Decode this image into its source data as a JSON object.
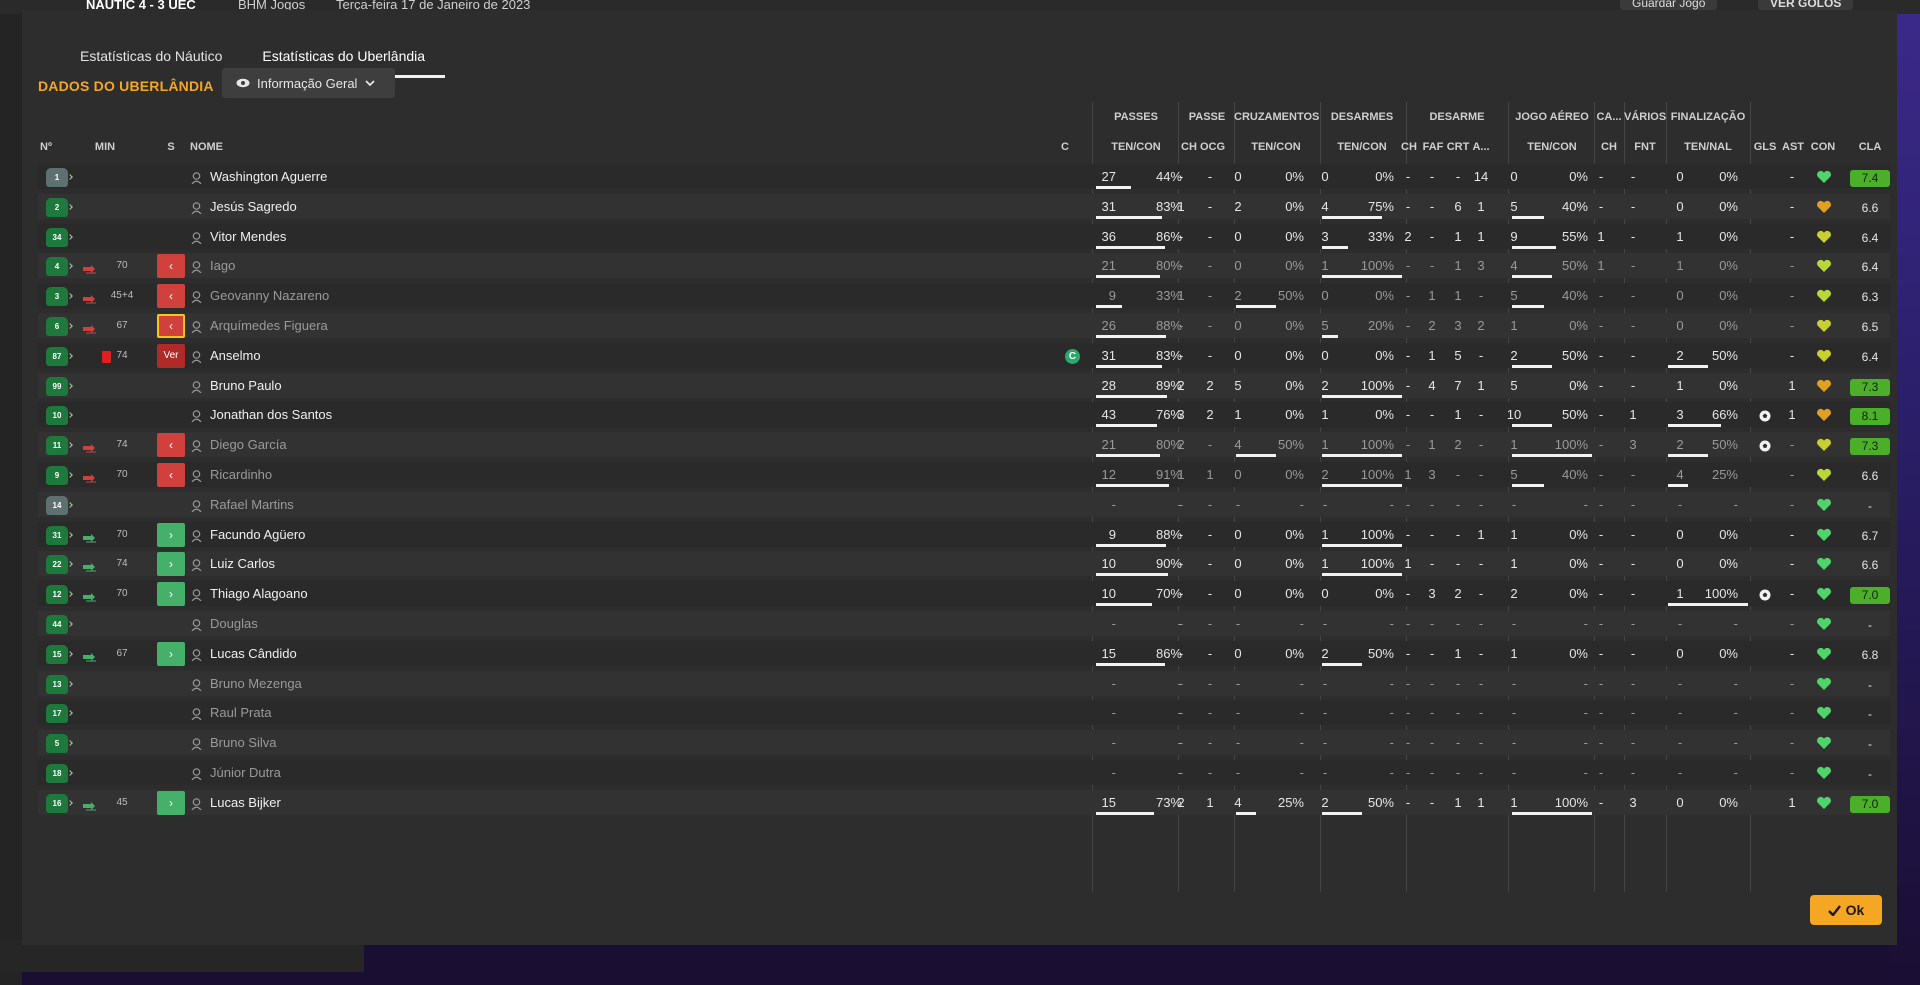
{
  "topbar": {
    "match": "NÁUTIC  4 - 3  UEC",
    "channel": "BHM Jogos",
    "date": "Terça-feira 17 de Janeiro de 2023",
    "save_button": "Guardar Jogo",
    "goals_button": "VER GOLOS"
  },
  "tabs": [
    "Estatísticas do Náutico",
    "Estatísticas do Uberlândia"
  ],
  "active_tab": 1,
  "section_title": "DADOS DO UBERLÂNDIA",
  "view_select": {
    "label": "Informação Geral"
  },
  "groups": [
    "PASSES",
    "PASSE",
    "CRUZAMENTOS",
    "DESARMES",
    "DESARME",
    "JOGO AÉREO",
    "CA...",
    "VÁRIOS",
    "FINALIZAÇÃO"
  ],
  "headers": {
    "num": "Nº",
    "min": "MIN",
    "s": "S",
    "name": "NOME",
    "c": "C",
    "passes": "TEN/CON",
    "passe_ch": "CH",
    "passe_ocg": "OCG",
    "cruz": "TEN/CON",
    "desarmes": "TEN/CON",
    "des_ch": "CH",
    "des_faf": "FAF",
    "des_crt": "CRT",
    "des_a": "A...",
    "aereo": "TEN/CON",
    "ca_ch": "CH",
    "varios_fnt": "FNT",
    "final": "TEN/NAL",
    "gls": "GLS",
    "ast": "AST",
    "con": "CON",
    "cla": "CLA"
  },
  "players": [
    {
      "num": "1",
      "gk": true,
      "min": "",
      "sub": "",
      "s": "",
      "name": "Washington Aguerre",
      "cap": false,
      "dim": false,
      "pt": "27",
      "pp": "44%",
      "ch": "-",
      "ocg": "-",
      "ct": "0",
      "cp": "0%",
      "dt": "0",
      "dp": "0%",
      "dch": "-",
      "faf": "-",
      "crt": "-",
      "da": "14",
      "at": "0",
      "ap": "0%",
      "cach": "-",
      "fnt": "-",
      "ft": "0",
      "fp": "0%",
      "gls": "",
      "ast": "-",
      "cla": "7.4",
      "good": true,
      "heart": "#4fd46a"
    },
    {
      "num": "2",
      "gk": false,
      "min": "",
      "sub": "",
      "s": "",
      "name": "Jesús Sagredo",
      "cap": false,
      "dim": false,
      "pt": "31",
      "pp": "83%",
      "ch": "1",
      "ocg": "-",
      "ct": "2",
      "cp": "0%",
      "dt": "4",
      "dp": "75%",
      "dch": "-",
      "faf": "-",
      "crt": "6",
      "da": "1",
      "at": "5",
      "ap": "40%",
      "cach": "-",
      "fnt": "-",
      "ft": "0",
      "fp": "0%",
      "gls": "",
      "ast": "-",
      "cla": "6.6",
      "good": false,
      "heart": "#e0a020"
    },
    {
      "num": "34",
      "gk": false,
      "min": "",
      "sub": "",
      "s": "",
      "name": "Vitor Mendes",
      "cap": false,
      "dim": false,
      "pt": "36",
      "pp": "86%",
      "ch": "-",
      "ocg": "-",
      "ct": "0",
      "cp": "0%",
      "dt": "3",
      "dp": "33%",
      "dch": "2",
      "faf": "-",
      "crt": "1",
      "da": "1",
      "at": "9",
      "ap": "55%",
      "cach": "1",
      "fnt": "-",
      "ft": "1",
      "fp": "0%",
      "gls": "",
      "ast": "-",
      "cla": "6.4",
      "good": false,
      "heart": "#c8d030"
    },
    {
      "num": "4",
      "gk": false,
      "min": "70",
      "sub": "out",
      "s": "out",
      "name": "Iago",
      "cap": false,
      "dim": true,
      "pt": "21",
      "pp": "80%",
      "ch": "-",
      "ocg": "-",
      "ct": "0",
      "cp": "0%",
      "dt": "1",
      "dp": "100%",
      "dch": "-",
      "faf": "-",
      "crt": "1",
      "da": "3",
      "at": "4",
      "ap": "50%",
      "cach": "1",
      "fnt": "-",
      "ft": "1",
      "fp": "0%",
      "gls": "",
      "ast": "-",
      "cla": "6.4",
      "good": false,
      "heart": "#b8d838"
    },
    {
      "num": "3",
      "gk": false,
      "min": "45+4",
      "sub": "out",
      "s": "out",
      "name": "Geovanny Nazareno",
      "cap": false,
      "dim": true,
      "pt": "9",
      "pp": "33%",
      "ch": "1",
      "ocg": "-",
      "ct": "2",
      "cp": "50%",
      "dt": "0",
      "dp": "0%",
      "dch": "-",
      "faf": "1",
      "crt": "1",
      "da": "-",
      "at": "5",
      "ap": "40%",
      "cach": "-",
      "fnt": "-",
      "ft": "0",
      "fp": "0%",
      "gls": "",
      "ast": "-",
      "cla": "6.3",
      "good": false,
      "heart": "#b8d838"
    },
    {
      "num": "6",
      "gk": false,
      "min": "67",
      "sub": "out",
      "s": "out-hl",
      "name": "Arquímedes Figuera",
      "cap": false,
      "dim": true,
      "pt": "26",
      "pp": "88%",
      "ch": "-",
      "ocg": "-",
      "ct": "0",
      "cp": "0%",
      "dt": "5",
      "dp": "20%",
      "dch": "-",
      "faf": "2",
      "crt": "3",
      "da": "2",
      "at": "1",
      "ap": "0%",
      "cach": "-",
      "fnt": "-",
      "ft": "0",
      "fp": "0%",
      "gls": "",
      "ast": "-",
      "cla": "6.5",
      "good": false,
      "heart": "#c8d030"
    },
    {
      "num": "87",
      "gk": false,
      "min": "74",
      "sub": "red",
      "s": "red",
      "name": "Anselmo",
      "cap": true,
      "dim": false,
      "pt": "31",
      "pp": "83%",
      "ch": "-",
      "ocg": "-",
      "ct": "0",
      "cp": "0%",
      "dt": "0",
      "dp": "0%",
      "dch": "-",
      "faf": "1",
      "crt": "5",
      "da": "-",
      "at": "2",
      "ap": "50%",
      "cach": "-",
      "fnt": "-",
      "ft": "2",
      "fp": "50%",
      "gls": "",
      "ast": "-",
      "cla": "6.4",
      "good": false,
      "heart": "#c8d030"
    },
    {
      "num": "99",
      "gk": false,
      "min": "",
      "sub": "",
      "s": "",
      "name": "Bruno Paulo",
      "cap": false,
      "dim": false,
      "pt": "28",
      "pp": "89%",
      "ch": "2",
      "ocg": "2",
      "ct": "5",
      "cp": "0%",
      "dt": "2",
      "dp": "100%",
      "dch": "-",
      "faf": "4",
      "crt": "7",
      "da": "1",
      "at": "5",
      "ap": "0%",
      "cach": "-",
      "fnt": "-",
      "ft": "1",
      "fp": "0%",
      "gls": "",
      "ast": "1",
      "cla": "7.3",
      "good": true,
      "heart": "#e0a020"
    },
    {
      "num": "10",
      "gk": false,
      "min": "",
      "sub": "",
      "s": "",
      "name": "Jonathan dos Santos",
      "cap": false,
      "dim": false,
      "pt": "43",
      "pp": "76%",
      "ch": "3",
      "ocg": "2",
      "ct": "1",
      "cp": "0%",
      "dt": "1",
      "dp": "0%",
      "dch": "-",
      "faf": "-",
      "crt": "1",
      "da": "-",
      "at": "10",
      "ap": "50%",
      "cach": "-",
      "fnt": "1",
      "ft": "3",
      "fp": "66%",
      "gls": "ball",
      "ast": "1",
      "cla": "8.1",
      "good": true,
      "heart": "#e0a020"
    },
    {
      "num": "11",
      "gk": false,
      "min": "74",
      "sub": "out",
      "s": "out",
      "name": "Diego García",
      "cap": false,
      "dim": true,
      "pt": "21",
      "pp": "80%",
      "ch": "2",
      "ocg": "-",
      "ct": "4",
      "cp": "50%",
      "dt": "1",
      "dp": "100%",
      "dch": "-",
      "faf": "1",
      "crt": "2",
      "da": "-",
      "at": "1",
      "ap": "100%",
      "cach": "-",
      "fnt": "3",
      "ft": "2",
      "fp": "50%",
      "gls": "ball",
      "ast": "-",
      "cla": "7.3",
      "good": true,
      "heart": "#c8d030"
    },
    {
      "num": "9",
      "gk": false,
      "min": "70",
      "sub": "out",
      "s": "out",
      "name": "Ricardinho",
      "cap": false,
      "dim": true,
      "pt": "12",
      "pp": "91%",
      "ch": "1",
      "ocg": "1",
      "ct": "0",
      "cp": "0%",
      "dt": "2",
      "dp": "100%",
      "dch": "1",
      "faf": "3",
      "crt": "-",
      "da": "-",
      "at": "5",
      "ap": "40%",
      "cach": "-",
      "fnt": "-",
      "ft": "4",
      "fp": "25%",
      "gls": "",
      "ast": "-",
      "cla": "6.6",
      "good": false,
      "heart": "#b8d838"
    },
    {
      "num": "14",
      "gk": true,
      "min": "",
      "sub": "",
      "s": "",
      "name": "Rafael Martins",
      "cap": false,
      "dim": true,
      "pt": "-",
      "pp": "-",
      "ch": "-",
      "ocg": "-",
      "ct": "-",
      "cp": "-",
      "dt": "-",
      "dp": "-",
      "dch": "-",
      "faf": "-",
      "crt": "-",
      "da": "-",
      "at": "-",
      "ap": "-",
      "cach": "-",
      "fnt": "-",
      "ft": "-",
      "fp": "-",
      "gls": "",
      "ast": "-",
      "cla": "-",
      "good": false,
      "heart": "#4fd46a"
    },
    {
      "num": "31",
      "gk": false,
      "min": "70",
      "sub": "in",
      "s": "in",
      "name": "Facundo Agüero",
      "cap": false,
      "dim": false,
      "pt": "9",
      "pp": "88%",
      "ch": "-",
      "ocg": "-",
      "ct": "0",
      "cp": "0%",
      "dt": "1",
      "dp": "100%",
      "dch": "-",
      "faf": "-",
      "crt": "-",
      "da": "1",
      "at": "1",
      "ap": "0%",
      "cach": "-",
      "fnt": "-",
      "ft": "0",
      "fp": "0%",
      "gls": "",
      "ast": "-",
      "cla": "6.7",
      "good": false,
      "heart": "#4fd46a"
    },
    {
      "num": "22",
      "gk": false,
      "min": "74",
      "sub": "in",
      "s": "in",
      "name": "Luiz Carlos",
      "cap": false,
      "dim": false,
      "pt": "10",
      "pp": "90%",
      "ch": "-",
      "ocg": "-",
      "ct": "0",
      "cp": "0%",
      "dt": "1",
      "dp": "100%",
      "dch": "1",
      "faf": "-",
      "crt": "-",
      "da": "-",
      "at": "1",
      "ap": "0%",
      "cach": "-",
      "fnt": "-",
      "ft": "0",
      "fp": "0%",
      "gls": "",
      "ast": "-",
      "cla": "6.6",
      "good": false,
      "heart": "#4fd46a"
    },
    {
      "num": "12",
      "gk": false,
      "min": "70",
      "sub": "in",
      "s": "in",
      "name": "Thiago Alagoano",
      "cap": false,
      "dim": false,
      "pt": "10",
      "pp": "70%",
      "ch": "-",
      "ocg": "-",
      "ct": "0",
      "cp": "0%",
      "dt": "0",
      "dp": "0%",
      "dch": "-",
      "faf": "3",
      "crt": "2",
      "da": "-",
      "at": "2",
      "ap": "0%",
      "cach": "-",
      "fnt": "-",
      "ft": "1",
      "fp": "100%",
      "gls": "ball",
      "ast": "-",
      "cla": "7.0",
      "good": true,
      "heart": "#4fd46a"
    },
    {
      "num": "44",
      "gk": false,
      "min": "",
      "sub": "",
      "s": "",
      "name": "Douglas",
      "cap": false,
      "dim": true,
      "pt": "-",
      "pp": "-",
      "ch": "-",
      "ocg": "-",
      "ct": "-",
      "cp": "-",
      "dt": "-",
      "dp": "-",
      "dch": "-",
      "faf": "-",
      "crt": "-",
      "da": "-",
      "at": "-",
      "ap": "-",
      "cach": "-",
      "fnt": "-",
      "ft": "-",
      "fp": "-",
      "gls": "",
      "ast": "-",
      "cla": "-",
      "good": false,
      "heart": "#4fd46a"
    },
    {
      "num": "15",
      "gk": false,
      "min": "67",
      "sub": "in",
      "s": "in",
      "name": "Lucas Cândido",
      "cap": false,
      "dim": false,
      "pt": "15",
      "pp": "86%",
      "ch": "-",
      "ocg": "-",
      "ct": "0",
      "cp": "0%",
      "dt": "2",
      "dp": "50%",
      "dch": "-",
      "faf": "-",
      "crt": "1",
      "da": "-",
      "at": "1",
      "ap": "0%",
      "cach": "-",
      "fnt": "-",
      "ft": "0",
      "fp": "0%",
      "gls": "",
      "ast": "-",
      "cla": "6.8",
      "good": false,
      "heart": "#4fd46a"
    },
    {
      "num": "13",
      "gk": false,
      "min": "",
      "sub": "",
      "s": "",
      "name": "Bruno Mezenga",
      "cap": false,
      "dim": true,
      "pt": "-",
      "pp": "-",
      "ch": "-",
      "ocg": "-",
      "ct": "-",
      "cp": "-",
      "dt": "-",
      "dp": "-",
      "dch": "-",
      "faf": "-",
      "crt": "-",
      "da": "-",
      "at": "-",
      "ap": "-",
      "cach": "-",
      "fnt": "-",
      "ft": "-",
      "fp": "-",
      "gls": "",
      "ast": "-",
      "cla": "-",
      "good": false,
      "heart": "#4fd46a"
    },
    {
      "num": "17",
      "gk": false,
      "min": "",
      "sub": "",
      "s": "",
      "name": "Raul Prata",
      "cap": false,
      "dim": true,
      "pt": "-",
      "pp": "-",
      "ch": "-",
      "ocg": "-",
      "ct": "-",
      "cp": "-",
      "dt": "-",
      "dp": "-",
      "dch": "-",
      "faf": "-",
      "crt": "-",
      "da": "-",
      "at": "-",
      "ap": "-",
      "cach": "-",
      "fnt": "-",
      "ft": "-",
      "fp": "-",
      "gls": "",
      "ast": "-",
      "cla": "-",
      "good": false,
      "heart": "#4fd46a"
    },
    {
      "num": "5",
      "gk": false,
      "min": "",
      "sub": "",
      "s": "",
      "name": "Bruno Silva",
      "cap": false,
      "dim": true,
      "pt": "-",
      "pp": "-",
      "ch": "-",
      "ocg": "-",
      "ct": "-",
      "cp": "-",
      "dt": "-",
      "dp": "-",
      "dch": "-",
      "faf": "-",
      "crt": "-",
      "da": "-",
      "at": "-",
      "ap": "-",
      "cach": "-",
      "fnt": "-",
      "ft": "-",
      "fp": "-",
      "gls": "",
      "ast": "-",
      "cla": "-",
      "good": false,
      "heart": "#4fd46a"
    },
    {
      "num": "18",
      "gk": false,
      "min": "",
      "sub": "",
      "s": "",
      "name": "Júnior Dutra",
      "cap": false,
      "dim": true,
      "pt": "-",
      "pp": "-",
      "ch": "-",
      "ocg": "-",
      "ct": "-",
      "cp": "-",
      "dt": "-",
      "dp": "-",
      "dch": "-",
      "faf": "-",
      "crt": "-",
      "da": "-",
      "at": "-",
      "ap": "-",
      "cach": "-",
      "fnt": "-",
      "ft": "-",
      "fp": "-",
      "gls": "",
      "ast": "-",
      "cla": "-",
      "good": false,
      "heart": "#4fd46a"
    },
    {
      "num": "16",
      "gk": false,
      "min": "45",
      "sub": "in",
      "s": "in",
      "name": "Lucas Bijker",
      "cap": false,
      "dim": false,
      "pt": "15",
      "pp": "73%",
      "ch": "2",
      "ocg": "1",
      "ct": "4",
      "cp": "25%",
      "dt": "2",
      "dp": "50%",
      "dch": "-",
      "faf": "-",
      "crt": "1",
      "da": "1",
      "at": "1",
      "ap": "100%",
      "cach": "-",
      "fnt": "3",
      "ft": "0",
      "fp": "0%",
      "gls": "",
      "ast": "1",
      "cla": "7.0",
      "good": true,
      "heart": "#4fd46a"
    }
  ],
  "red_card_label": "Ver",
  "captain_label": "C",
  "ok_button": "Ok",
  "colors": {
    "accent": "#f5a623",
    "positive": "#45b06a",
    "negative": "#d0413e",
    "rating_good": "#4caf2a"
  }
}
